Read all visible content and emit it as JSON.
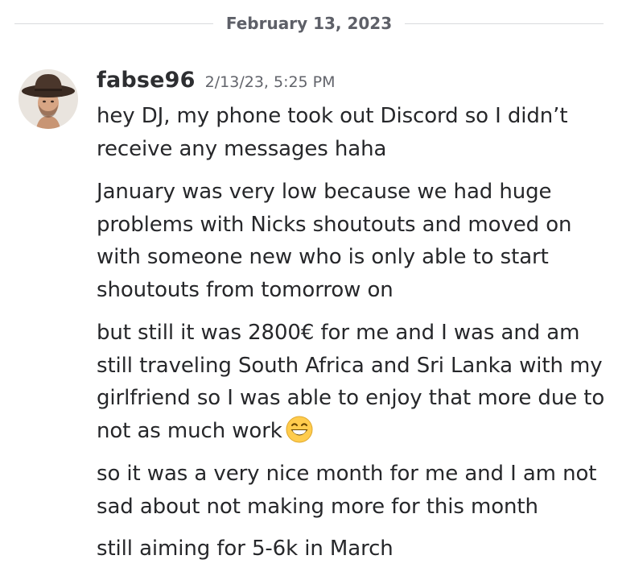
{
  "divider": {
    "date": "February 13, 2023"
  },
  "message_group": {
    "username": "fabse96",
    "timestamp": "2/13/23, 5:25 PM",
    "avatar_icon": "profile-photo-cowboy-hat",
    "messages": [
      "hey DJ, my phone took out Discord so I didn’t receive any messages haha",
      "January was very low because we had huge problems with Nicks shoutouts and moved on with someone new who is only able to start shoutouts from tomorrow on",
      "but still it was 2800€ for me and I was and am still traveling South Africa and Sri Lanka with my girlfriend so I was able to enjoy that more due to not as much work",
      "so it was a very nice month for me and I am not sad about not making more for this month",
      "still aiming for 5-6k in March"
    ],
    "emoji_icon": "grinning-face-with-smiling-eyes-emoji"
  }
}
